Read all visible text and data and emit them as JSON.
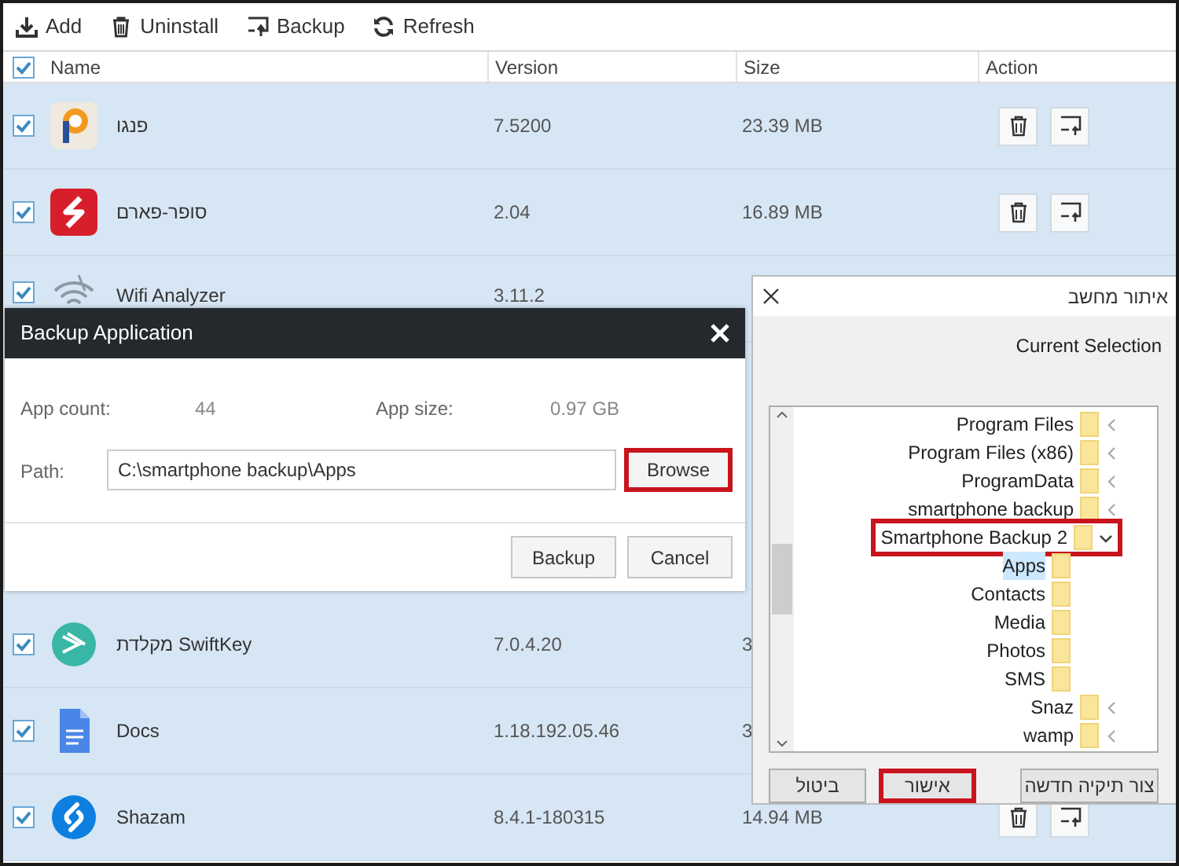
{
  "toolbar": [
    {
      "label": "Add"
    },
    {
      "label": "Uninstall"
    },
    {
      "label": "Backup"
    },
    {
      "label": "Refresh"
    }
  ],
  "table": {
    "select_all_checked": true,
    "columns": [
      "Name",
      "Version",
      "Size",
      "Action"
    ],
    "rows": [
      {
        "name": "פנגו",
        "version": "7.5200",
        "size": "23.39 MB",
        "checked": true,
        "actions_visible": true
      },
      {
        "name": "סופר-פארם",
        "version": "2.04",
        "size": "16.89 MB",
        "checked": true,
        "actions_visible": true
      },
      {
        "name": "Wifi Analyzer",
        "version": "3.11.2",
        "checked": true,
        "actions_visible": false
      },
      {
        "name": "מקלדת SwiftKey",
        "version": "7.0.4.20",
        "size": "3",
        "checked": true,
        "actions_visible": false
      },
      {
        "name": "Docs",
        "version": "1.18.192.05.46",
        "size": "3",
        "checked": true,
        "actions_visible": false
      },
      {
        "name": "Shazam",
        "version": "8.4.1-180315",
        "size": "14.94 MB",
        "checked": true,
        "actions_visible": true
      }
    ]
  },
  "backup_dialog": {
    "title": "Backup Application",
    "app_count_label": "App count:",
    "app_count": "44",
    "app_size_label": "App size:",
    "app_size": "0.97 GB",
    "path_label": "Path:",
    "path": "C:\\smartphone backup\\Apps",
    "browse": {
      "label": "Browse",
      "highlighted": true
    },
    "buttons": [
      {
        "label": "Backup",
        "highlighted": false
      },
      {
        "label": "Cancel",
        "highlighted": false
      }
    ]
  },
  "folder_dialog": {
    "title": "איתור מחשב",
    "current_selection": "Current Selection",
    "tree": [
      {
        "label": "Program Files",
        "expanded": false,
        "selected": false,
        "highlighted": false
      },
      {
        "label": "Program Files (x86)",
        "expanded": false,
        "selected": false,
        "highlighted": false
      },
      {
        "label": "ProgramData",
        "expanded": false,
        "selected": false,
        "highlighted": false
      },
      {
        "label": "smartphone backup",
        "expanded": false,
        "selected": false,
        "highlighted": false
      },
      {
        "label": "Smartphone Backup 2",
        "expanded": true,
        "selected": false,
        "highlighted": true,
        "children": [
          {
            "label": "Apps",
            "selected": true,
            "highlighted": false
          },
          {
            "label": "Contacts",
            "selected": false,
            "highlighted": false
          },
          {
            "label": "Media",
            "selected": false,
            "highlighted": false
          },
          {
            "label": "Photos",
            "selected": false,
            "highlighted": false
          },
          {
            "label": "SMS",
            "selected": false,
            "highlighted": false
          }
        ]
      },
      {
        "label": "Snaz",
        "expanded": false,
        "selected": false,
        "highlighted": false
      },
      {
        "label": "wamp",
        "expanded": false,
        "selected": false,
        "highlighted": false
      }
    ],
    "buttons": [
      {
        "label": "צור תיקיה חדשה",
        "highlighted": false
      },
      {
        "label": "אישור",
        "highlighted": true
      },
      {
        "label": "ביטול",
        "highlighted": false
      }
    ]
  }
}
